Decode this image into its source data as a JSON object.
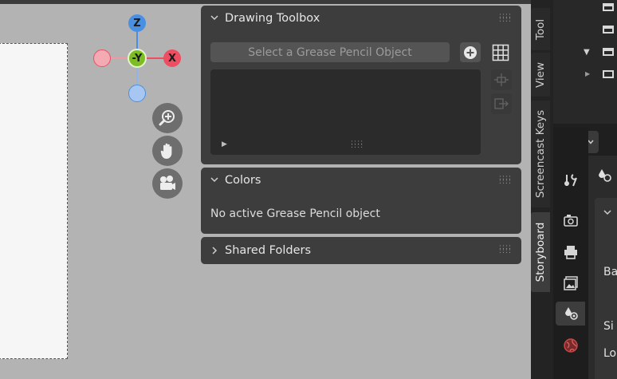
{
  "gizmo": {
    "z_label": "Z",
    "y_label": "-Y",
    "x_label": "X"
  },
  "nav_buttons": [
    "zoom-icon",
    "hand-pan-icon",
    "camera-icon"
  ],
  "panels": {
    "drawing_toolbox": {
      "title": "Drawing Toolbox",
      "select_label": "Select a Grease Pencil Object",
      "play_glyph": "▶"
    },
    "colors": {
      "title": "Colors",
      "message": "No active Grease Pencil object"
    },
    "shared_folders": {
      "title": "Shared Folders"
    }
  },
  "side_tabs": [
    {
      "label": "Tool",
      "active": false
    },
    {
      "label": "View",
      "active": false
    },
    {
      "label": "Screencast Keys",
      "active": false
    },
    {
      "label": "Storyboard",
      "active": true
    }
  ],
  "properties_partial_labels": [
    "Ba",
    "Si",
    "Lo"
  ],
  "colors": {
    "z_axis": "#4a90e2",
    "x_axis": "#ee4e62",
    "y_axis": "#7cbd22",
    "panel_bg": "#3d3d3d",
    "viewport_bg": "#b3b3b3"
  }
}
